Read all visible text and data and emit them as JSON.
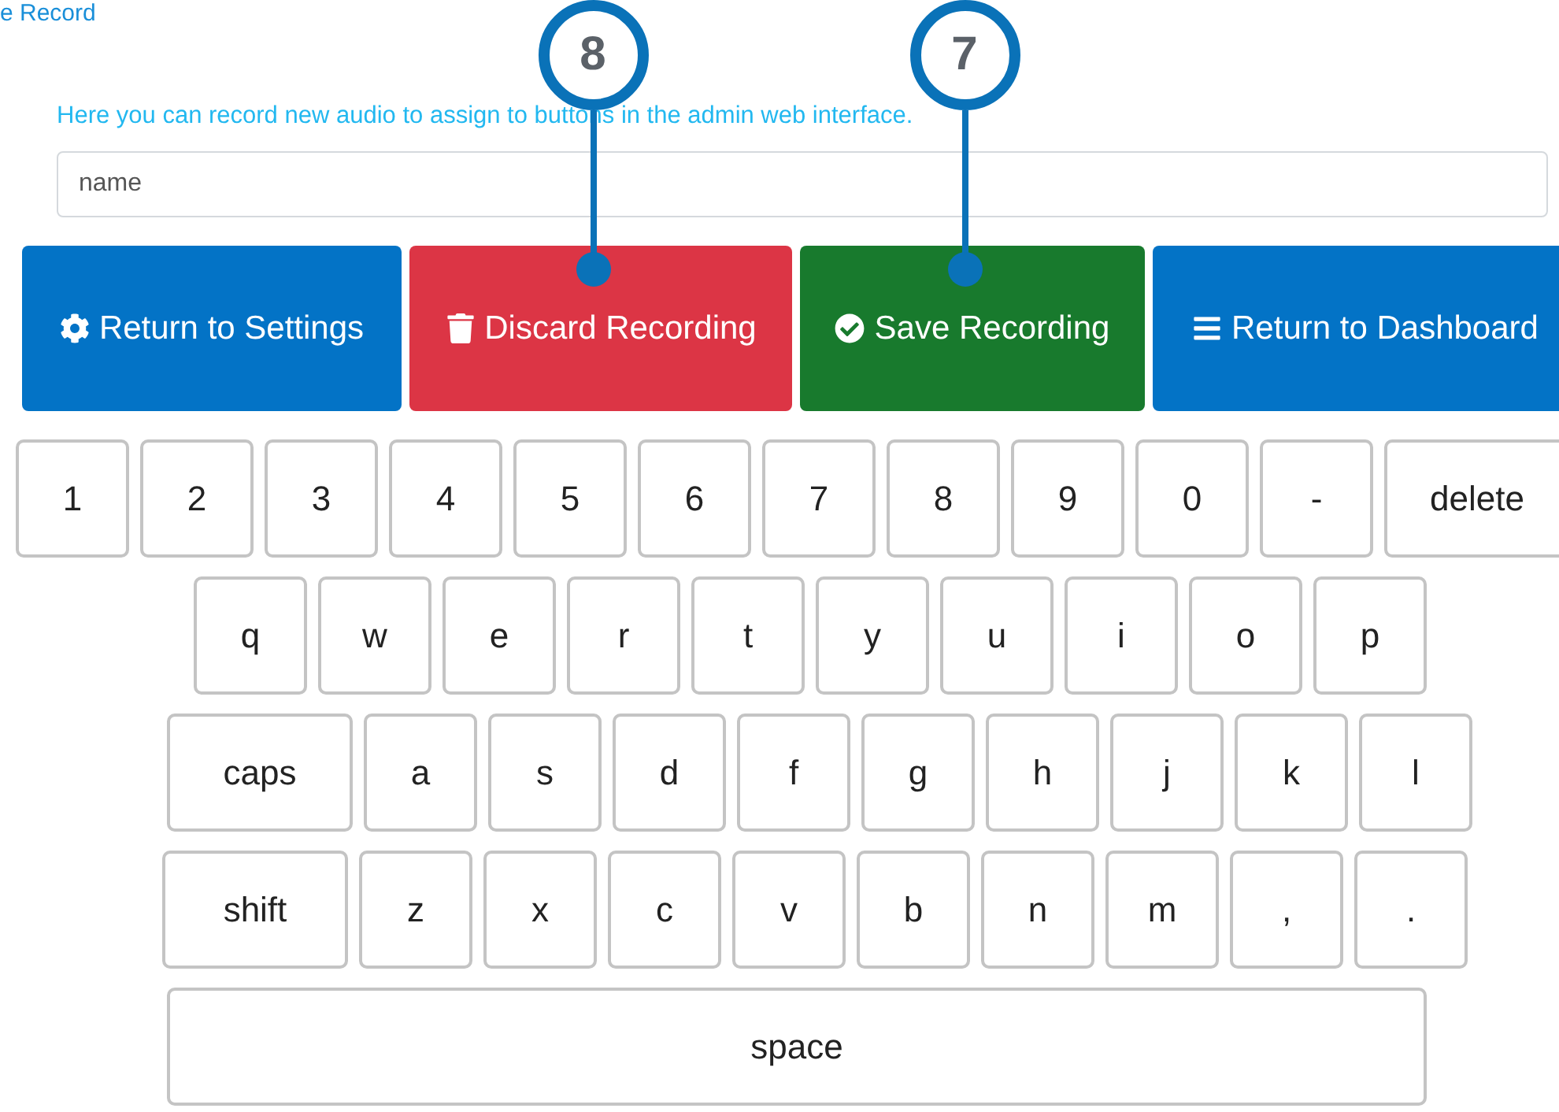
{
  "breadcrumb": "e Record",
  "description": "Here you can record new audio to assign to buttons in the admin web interface.",
  "name_field": {
    "placeholder": "name"
  },
  "buttons": [
    {
      "kind": "settings",
      "label": "Return to Settings"
    },
    {
      "kind": "discard",
      "label": "Discard Recording",
      "callout": "8"
    },
    {
      "kind": "save",
      "label": "Save Recording",
      "callout": "7"
    },
    {
      "kind": "dashboard",
      "label": "Return to Dashboard"
    }
  ],
  "keyboard": [
    [
      {
        "label": "1"
      },
      {
        "label": "2"
      },
      {
        "label": "3"
      },
      {
        "label": "4"
      },
      {
        "label": "5"
      },
      {
        "label": "6"
      },
      {
        "label": "7"
      },
      {
        "label": "8"
      },
      {
        "label": "9"
      },
      {
        "label": "0"
      },
      {
        "label": "-"
      },
      {
        "label": "delete",
        "kind": "wide"
      }
    ],
    [
      {
        "label": "q"
      },
      {
        "label": "w"
      },
      {
        "label": "e"
      },
      {
        "label": "r"
      },
      {
        "label": "t"
      },
      {
        "label": "y"
      },
      {
        "label": "u"
      },
      {
        "label": "i"
      },
      {
        "label": "o"
      },
      {
        "label": "p"
      }
    ],
    [
      {
        "label": "caps",
        "kind": "wide"
      },
      {
        "label": "a"
      },
      {
        "label": "s"
      },
      {
        "label": "d"
      },
      {
        "label": "f"
      },
      {
        "label": "g"
      },
      {
        "label": "h"
      },
      {
        "label": "j"
      },
      {
        "label": "k"
      },
      {
        "label": "l"
      }
    ],
    [
      {
        "label": "shift",
        "kind": "wide"
      },
      {
        "label": "z"
      },
      {
        "label": "x"
      },
      {
        "label": "c"
      },
      {
        "label": "v"
      },
      {
        "label": "b"
      },
      {
        "label": "n"
      },
      {
        "label": "m"
      },
      {
        "label": ","
      },
      {
        "label": "."
      }
    ],
    [
      {
        "label": "space",
        "kind": "space"
      }
    ]
  ]
}
